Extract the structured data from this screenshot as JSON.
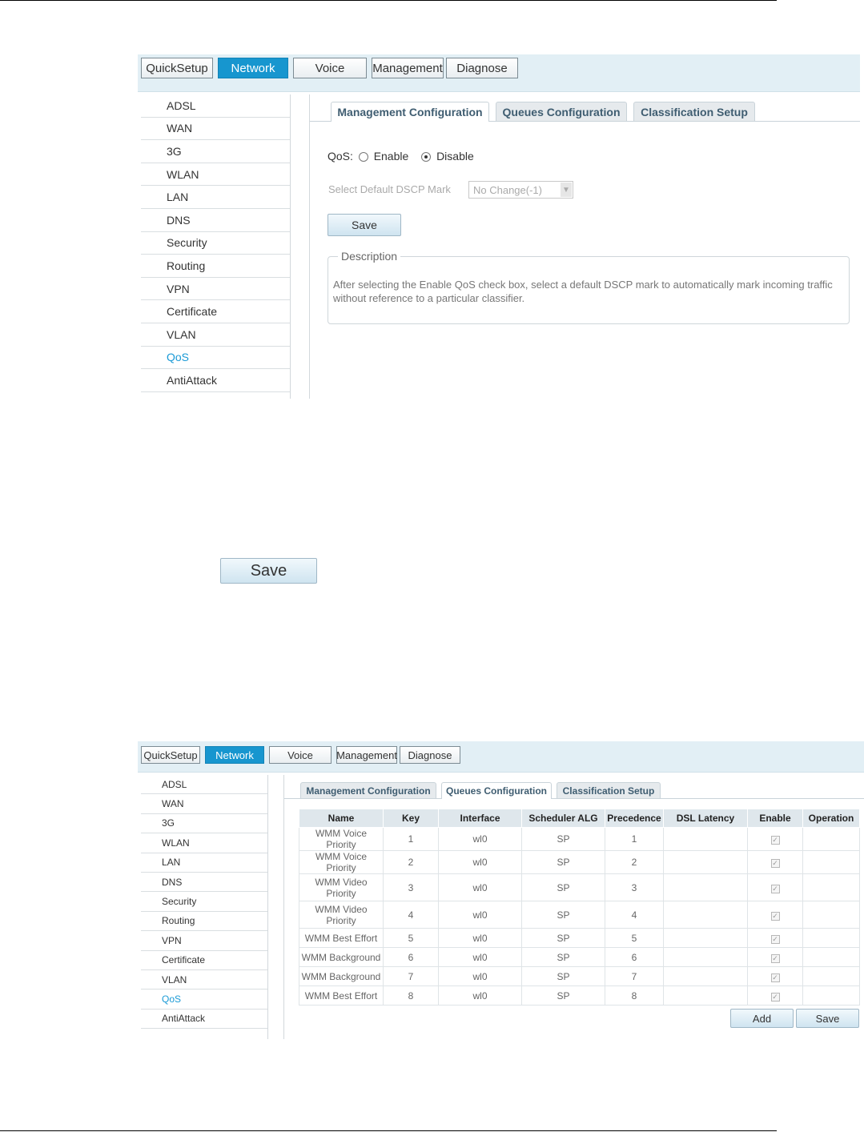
{
  "nav": [
    "QuickSetup",
    "Network",
    "Voice",
    "Management",
    "Diagnose"
  ],
  "nav_active": "Network",
  "sidebar": [
    "ADSL",
    "WAN",
    "3G",
    "WLAN",
    "LAN",
    "DNS",
    "Security",
    "Routing",
    "VPN",
    "Certificate",
    "VLAN",
    "QoS",
    "AntiAttack"
  ],
  "sidebar_active": "QoS",
  "subtabs": [
    "Management Configuration",
    "Queues Configuration",
    "Classification Setup"
  ],
  "panel1": {
    "qos_label": "QoS:",
    "enable_label": "Enable",
    "disable_label": "Disable",
    "dscp_label": "Select Default DSCP Mark",
    "dscp_value": "No Change(-1)",
    "save_label": "Save",
    "description_title": "Description",
    "description_text": "After selecting the Enable QoS check box, select a default DSCP mark to automatically mark incoming traffic without reference to a particular classifier."
  },
  "standalone_save": "Save",
  "panel2": {
    "columns": [
      "Name",
      "Key",
      "Interface",
      "Scheduler ALG",
      "Precedence",
      "DSL Latency",
      "Enable",
      "Operation"
    ],
    "rows": [
      {
        "name": "WMM Voice Priority",
        "key": "1",
        "iface": "wl0",
        "alg": "SP",
        "prec": "1"
      },
      {
        "name": "WMM Voice Priority",
        "key": "2",
        "iface": "wl0",
        "alg": "SP",
        "prec": "2"
      },
      {
        "name": "WMM Video Priority",
        "key": "3",
        "iface": "wl0",
        "alg": "SP",
        "prec": "3"
      },
      {
        "name": "WMM Video Priority",
        "key": "4",
        "iface": "wl0",
        "alg": "SP",
        "prec": "4"
      },
      {
        "name": "WMM Best Effort",
        "key": "5",
        "iface": "wl0",
        "alg": "SP",
        "prec": "5"
      },
      {
        "name": "WMM Background",
        "key": "6",
        "iface": "wl0",
        "alg": "SP",
        "prec": "6"
      },
      {
        "name": "WMM Background",
        "key": "7",
        "iface": "wl0",
        "alg": "SP",
        "prec": "7"
      },
      {
        "name": "WMM Best Effort",
        "key": "8",
        "iface": "wl0",
        "alg": "SP",
        "prec": "8"
      }
    ],
    "add_label": "Add",
    "save_label": "Save"
  }
}
